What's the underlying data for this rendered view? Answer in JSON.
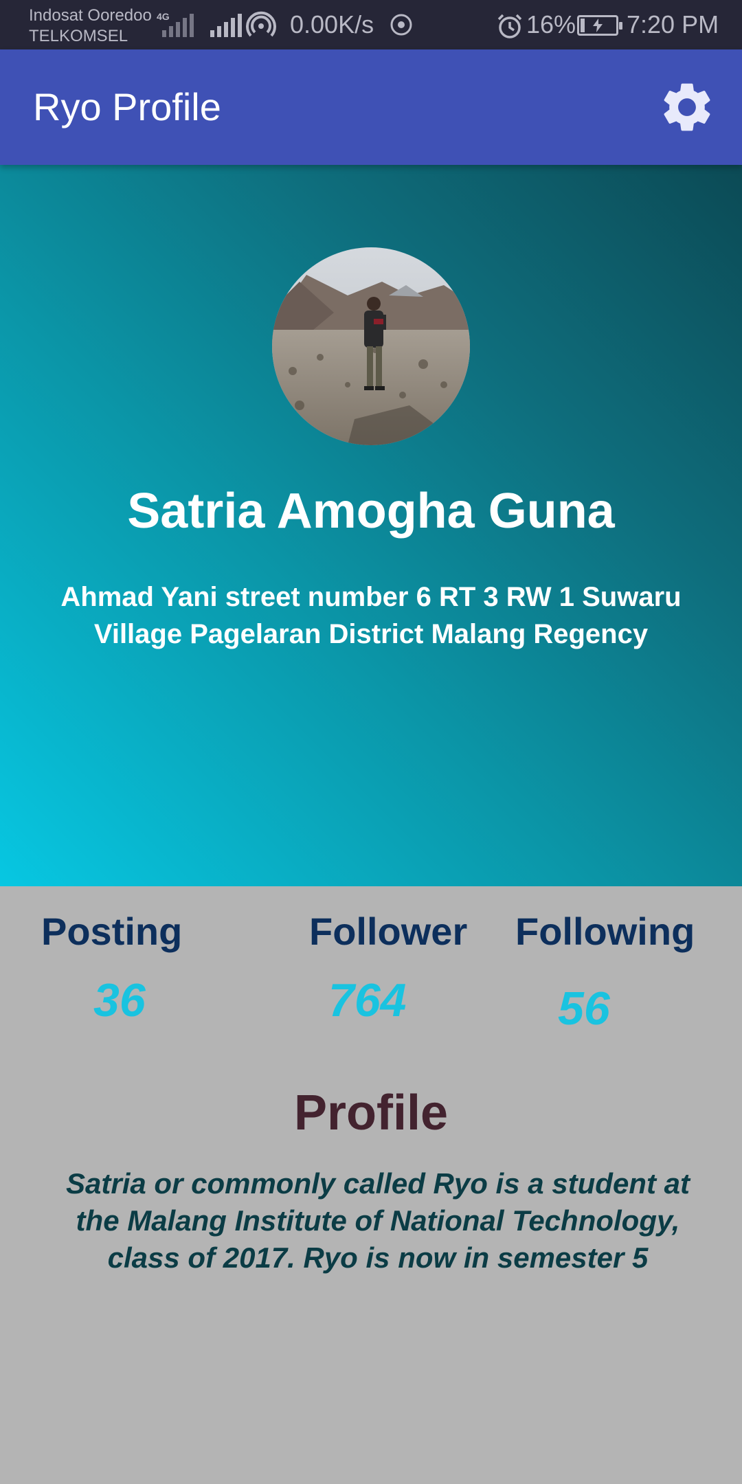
{
  "status_bar": {
    "carrier_1": "Indosat Ooredoo",
    "carrier_2": "TELKOMSEL",
    "network_type": "4G",
    "speed": "0.00K/s",
    "battery": "16%",
    "time": "7:20 PM"
  },
  "app_bar": {
    "title": "Ryo Profile",
    "settings_icon": "gear-icon",
    "color": "#3f51b5"
  },
  "profile": {
    "name": "Satria Amogha Guna",
    "address": "Ahmad Yani street number 6 RT 3 RW 1 Suwaru Village Pagelaran District Malang Regency",
    "avatar_icon": "profile-photo"
  },
  "stats": {
    "posting_label": "Posting",
    "posting_value": "36",
    "follower_label": "Follower",
    "follower_value": "764",
    "following_label": "Following",
    "following_value": "56"
  },
  "about": {
    "title": "Profile",
    "text": "Satria or commonly called Ryo is a student at the Malang Institute of National Technology, class of 2017. Ryo is now in semester 5"
  },
  "colors": {
    "accent": "#19c3e0",
    "label": "#0d2f5c",
    "gradient_start": "#07c7e2",
    "gradient_end": "#0c4a55"
  }
}
